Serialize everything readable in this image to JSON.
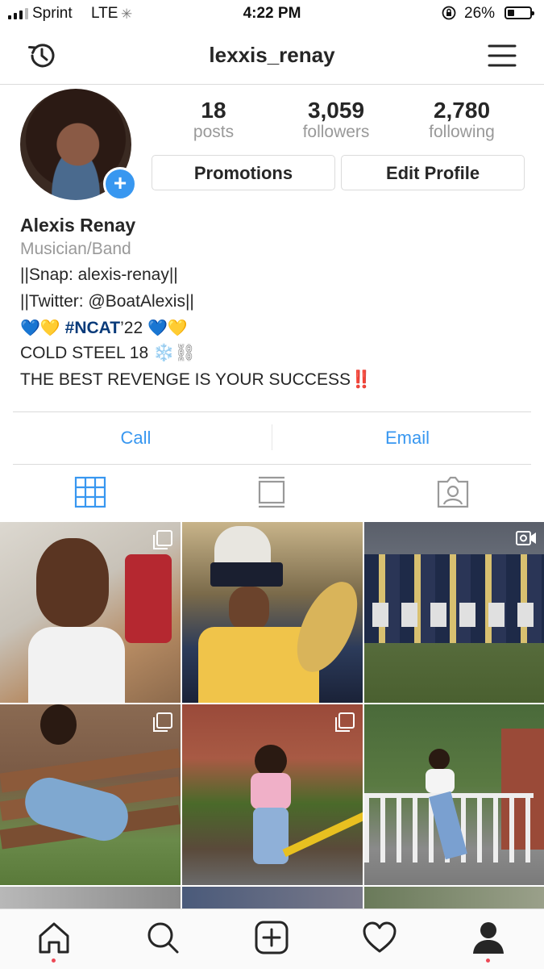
{
  "status_bar": {
    "carrier": "Sprint",
    "network": "LTE",
    "time": "4:22 PM",
    "battery": "26%",
    "battery_level": 0.26
  },
  "header": {
    "username": "lexxis_renay",
    "left_icon": "history-icon",
    "right_icon": "menu-icon"
  },
  "profile": {
    "stats": [
      {
        "value": "18",
        "label": "posts"
      },
      {
        "value": "3,059",
        "label": "followers"
      },
      {
        "value": "2,780",
        "label": "following"
      }
    ],
    "buttons": {
      "promotions": "Promotions",
      "edit_profile": "Edit Profile"
    },
    "name": "Alexis Renay",
    "category": "Musician/Band",
    "bio": {
      "line1": "||Snap: alexis-renay||",
      "line2": "||Twitter: @BoatAlexis||",
      "line3_hashtag": "#NCAT",
      "line3_suffix": "’22",
      "line4": "COLD STEEL 18",
      "line5": "THE BEST REVENGE IS YOUR SUCCESS",
      "emoji": {
        "blue_heart": "💙",
        "yellow_heart": "💛",
        "snowflake": "❄️",
        "chains": "⛓",
        "exclamation": "‼️"
      }
    }
  },
  "contact": {
    "call": "Call",
    "email": "Email"
  },
  "colors": {
    "link_blue": "#3897f0",
    "border": "#dbdbdb",
    "muted": "#999999",
    "notification_red": "#ed4956"
  },
  "tabs": [
    "grid-icon",
    "feed-icon",
    "tagged-icon"
  ],
  "nav": [
    "home-icon",
    "search-icon",
    "add-post-icon",
    "activity-heart-icon",
    "profile-icon"
  ]
}
